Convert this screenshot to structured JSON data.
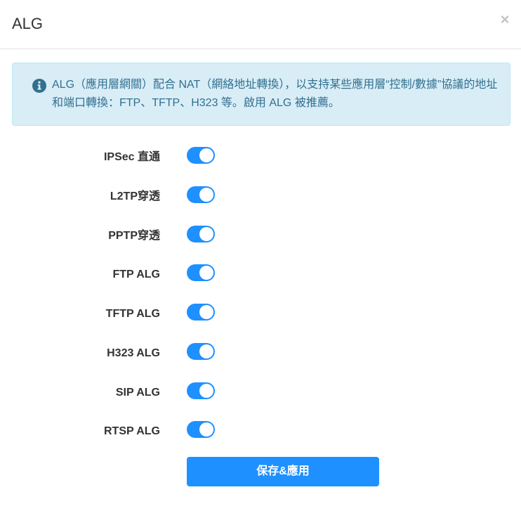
{
  "header": {
    "title": "ALG",
    "close_label": "×"
  },
  "alert": {
    "icon": "info-circle-icon",
    "text": "ALG（應用層網關）配合 NAT（網絡地址轉換），以支持某些應用層“控制/數據”協議的地址和端口轉換：FTP、TFTP、H323 等。啟用 ALG 被推薦。"
  },
  "settings": [
    {
      "label": "IPSec 直通",
      "enabled": true
    },
    {
      "label": "L2TP穿透",
      "enabled": true
    },
    {
      "label": "PPTP穿透",
      "enabled": true
    },
    {
      "label": "FTP ALG",
      "enabled": true
    },
    {
      "label": "TFTP ALG",
      "enabled": true
    },
    {
      "label": "H323 ALG",
      "enabled": true
    },
    {
      "label": "SIP ALG",
      "enabled": true
    },
    {
      "label": "RTSP ALG",
      "enabled": true
    }
  ],
  "save_button": {
    "label": "保存&應用"
  },
  "colors": {
    "accent": "#1e90ff",
    "alert_bg": "#d9edf7",
    "alert_text": "#31708f"
  }
}
